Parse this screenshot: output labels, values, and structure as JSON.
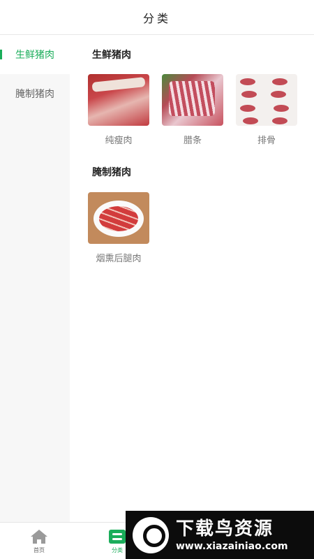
{
  "header": {
    "title": "分类"
  },
  "sidebar": {
    "items": [
      {
        "label": "生鲜猪肉",
        "active": true
      },
      {
        "label": "腌制猪肉",
        "active": false
      }
    ]
  },
  "sections": [
    {
      "title": "生鲜猪肉",
      "products": [
        {
          "label": "纯瘦肉",
          "image": "lean-pork-photo"
        },
        {
          "label": "腊条",
          "image": "pork-ribs-strip-photo"
        },
        {
          "label": "排骨",
          "image": "spare-ribs-photo"
        }
      ]
    },
    {
      "title": "腌制猪肉",
      "products": [
        {
          "label": "烟熏后腿肉",
          "image": "smoked-ham-photo"
        }
      ]
    }
  ],
  "tabbar": {
    "items": [
      {
        "label": "首页",
        "icon": "home-icon"
      },
      {
        "label": "分类",
        "icon": "category-icon",
        "active": true
      }
    ]
  },
  "watermark": {
    "title": "下载鸟资源",
    "url": "www.xiazainiao.com"
  },
  "colors": {
    "accent": "#1aad5a",
    "sidebar_bg": "#f7f7f7",
    "watermark_bg": "#0c0c0c"
  }
}
